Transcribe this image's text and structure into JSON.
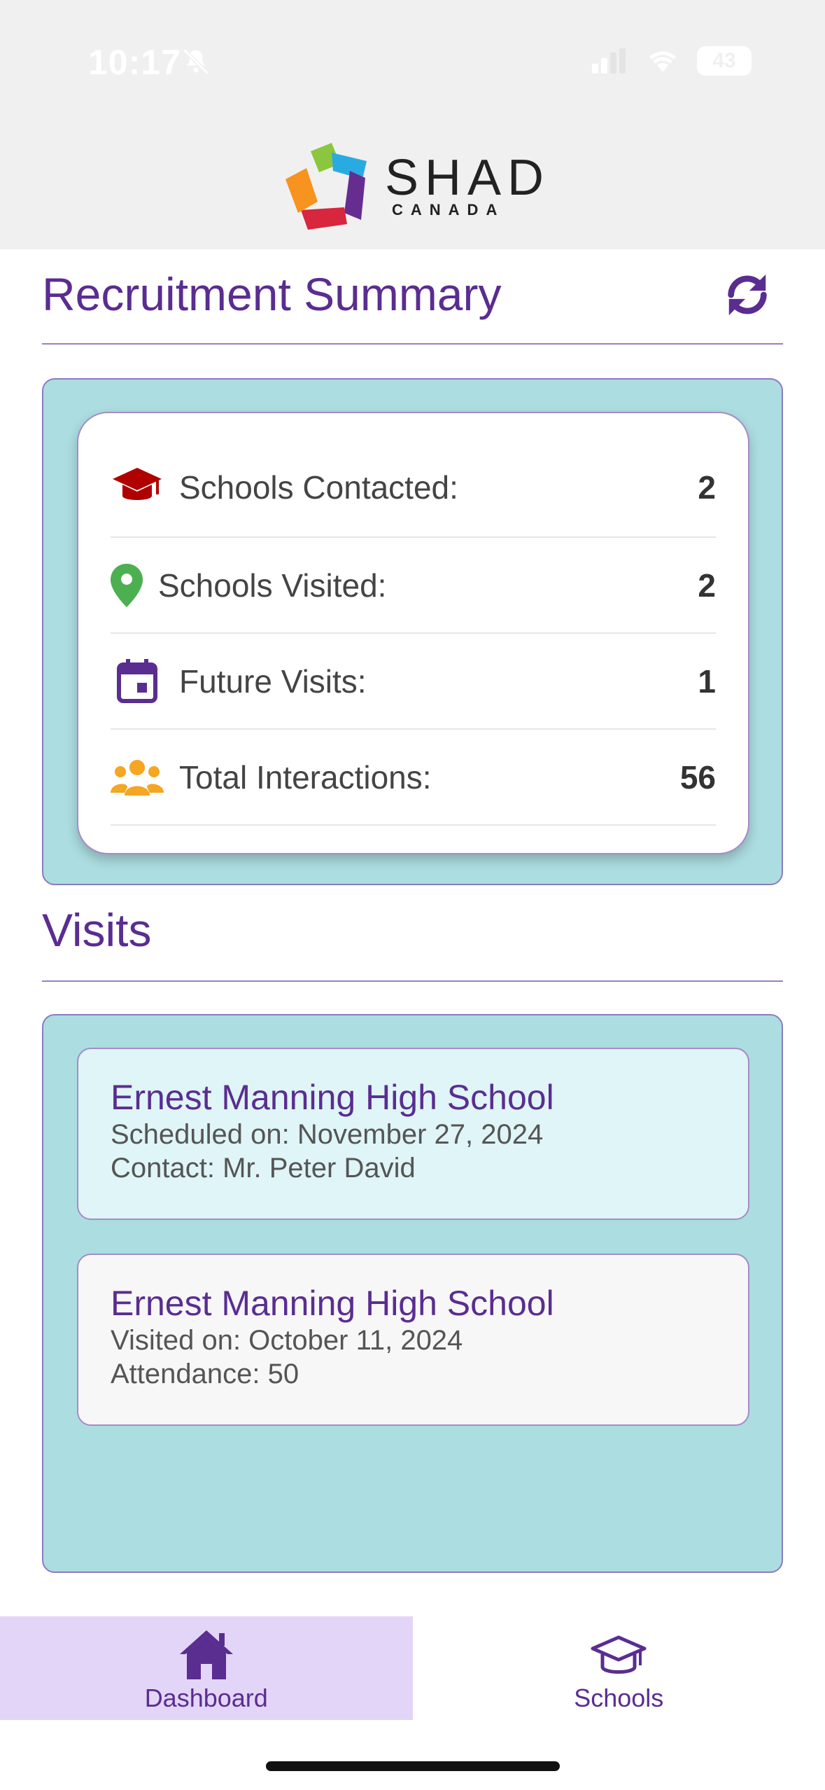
{
  "status_bar": {
    "time": "10:17",
    "battery": "43"
  },
  "brand": {
    "name": "SHAD",
    "sub": "CANADA"
  },
  "summary": {
    "title": "Recruitment Summary",
    "stats": [
      {
        "icon": "graduation-cap-icon",
        "label": "Schools Contacted:",
        "value": "2"
      },
      {
        "icon": "map-pin-icon",
        "label": "Schools Visited:",
        "value": "2"
      },
      {
        "icon": "calendar-icon",
        "label": "Future Visits:",
        "value": "1"
      },
      {
        "icon": "users-icon",
        "label": "Total Interactions:",
        "value": "56"
      }
    ]
  },
  "visits": {
    "title": "Visits",
    "items": [
      {
        "school": "Ernest Manning High School",
        "line1": "Scheduled on: November 27, 2024",
        "line2": "Contact: Mr. Peter David",
        "bg": "#dff5f7"
      },
      {
        "school": "Ernest Manning High School",
        "line1": "Visited on: October 11, 2024",
        "line2": "Attendance: 50",
        "bg": "#f7f7f7"
      }
    ]
  },
  "nav": {
    "items": [
      {
        "label": "Dashboard",
        "icon": "home-icon",
        "active": true
      },
      {
        "label": "Schools",
        "icon": "school-cap-icon",
        "active": false
      }
    ]
  },
  "colors": {
    "accent": "#5a2d91",
    "panel": "#acdde0",
    "nav_active": "#e3d5f7"
  }
}
